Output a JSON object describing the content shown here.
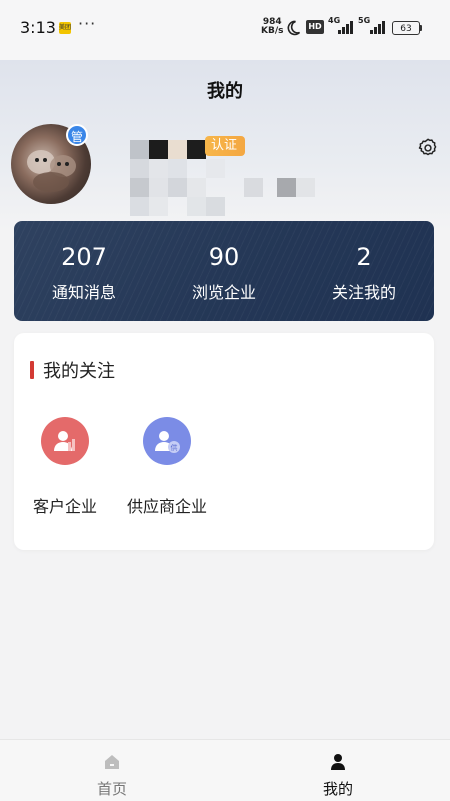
{
  "status_bar": {
    "time": "3:13",
    "app_icon_text": "美团",
    "dots": "···",
    "net_speed_value": "984",
    "net_speed_unit": "KB/s",
    "hd_label": "HD",
    "signal1": "4G",
    "signal2": "5G",
    "battery": "63"
  },
  "header": {
    "title": "我的"
  },
  "profile": {
    "avatar_badge": "管",
    "verify_badge": "认证"
  },
  "stats": [
    {
      "value": "207",
      "label": "通知消息"
    },
    {
      "value": "90",
      "label": "浏览企业"
    },
    {
      "value": "2",
      "label": "关注我的"
    }
  ],
  "follow": {
    "title": "我的关注",
    "items": [
      {
        "label": "客户企业",
        "icon": "customer-company-icon",
        "color": "#e46a6a"
      },
      {
        "label": "供应商企业",
        "icon": "supplier-company-icon",
        "color": "#7b8ce6"
      }
    ]
  },
  "tabbar": {
    "tabs": [
      {
        "label": "首页",
        "icon": "home-icon",
        "active": false
      },
      {
        "label": "我的",
        "icon": "person-icon",
        "active": true
      }
    ]
  },
  "colors": {
    "accent": "#253857",
    "section_bar": "#d33a33",
    "badge": "#f4a742",
    "tab_active": "#111111",
    "tab_inactive": "#777777"
  }
}
